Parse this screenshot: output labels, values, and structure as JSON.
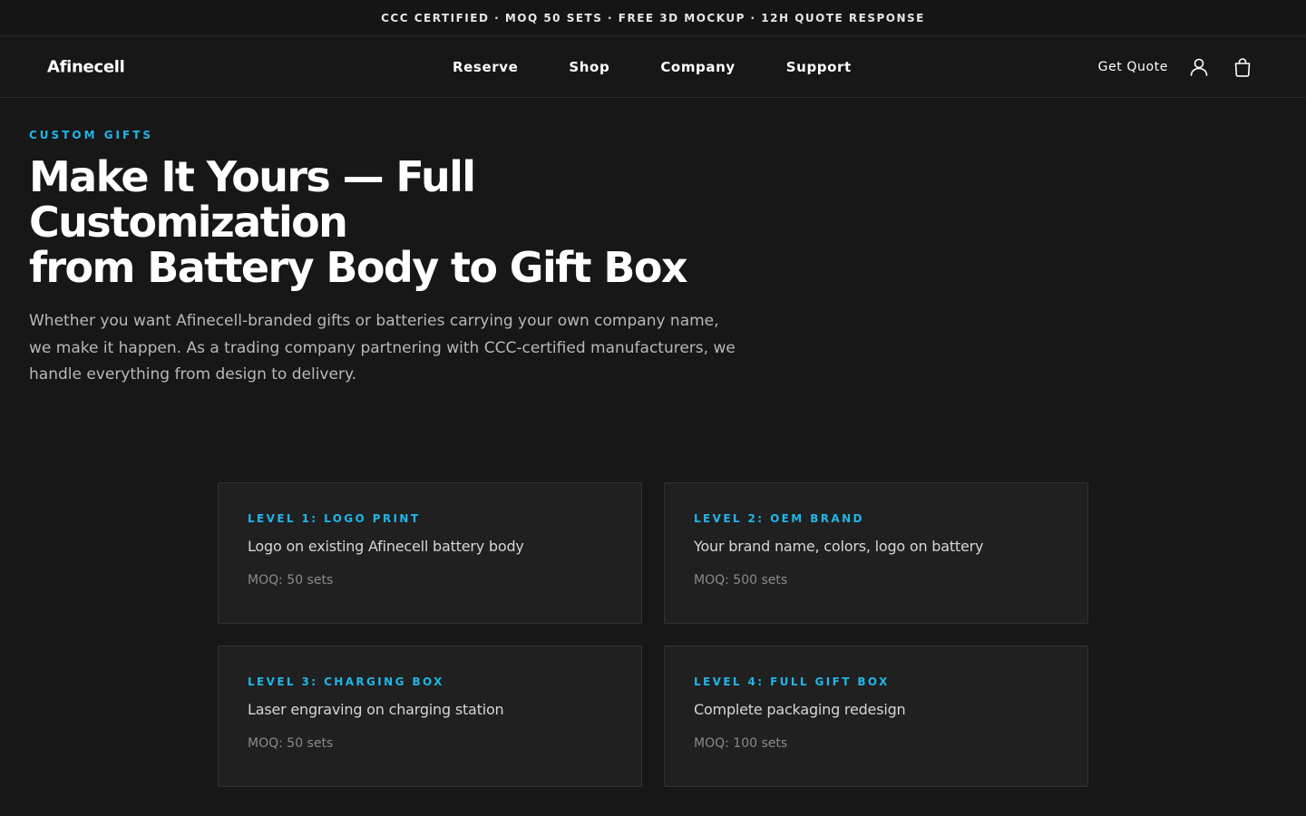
{
  "announcement": "CCC CERTIFIED · MOQ 50 SETS · FREE 3D MOCKUP · 12H QUOTE RESPONSE",
  "header": {
    "logo": "Afinecell",
    "nav": [
      "Reserve",
      "Shop",
      "Company",
      "Support"
    ],
    "get_quote": "Get Quote",
    "icons": [
      "user-icon",
      "shopping-bag-icon"
    ]
  },
  "hero": {
    "eyebrow": "CUSTOM GIFTS",
    "title_line1": "Make It Yours — Full Customization",
    "title_line2": "from Battery Body to Gift Box",
    "description": "Whether you want Afinecell-branded gifts or batteries carrying your own company name, we make it happen. As a trading company partnering with CCC-certified manufacturers, we handle everything from design to delivery."
  },
  "levels": [
    {
      "label": "LEVEL 1: LOGO PRINT",
      "description": "Logo on existing Afinecell battery body",
      "moq": "MOQ: 50 sets"
    },
    {
      "label": "LEVEL 2: OEM BRAND",
      "description": "Your brand name, colors, logo on battery",
      "moq": "MOQ: 500 sets"
    },
    {
      "label": "LEVEL 3: CHARGING BOX",
      "description": "Laser engraving on charging station",
      "moq": "MOQ: 50 sets"
    },
    {
      "label": "LEVEL 4: FULL GIFT BOX",
      "description": "Complete packaging redesign",
      "moq": "MOQ: 100 sets"
    }
  ],
  "colors": {
    "background": "#171717",
    "card": "#202020",
    "accent": "#1fb6e8",
    "text_primary": "#ffffff",
    "text_muted": "#b8b8b8"
  }
}
